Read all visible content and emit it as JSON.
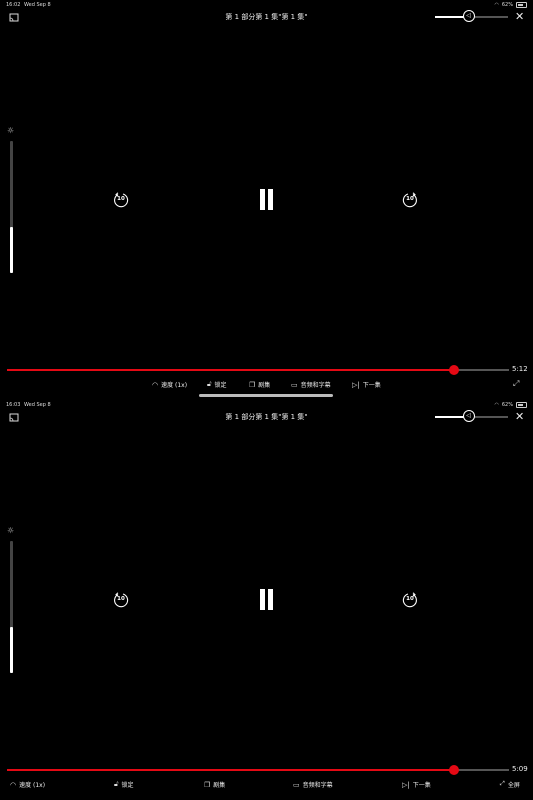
{
  "panels": [
    {
      "status": {
        "time": "16:02",
        "date": "Wed Sep 8",
        "battery": "62%"
      },
      "title": "第 1 部分第 1 集\"第 1 集\"",
      "volume_level": 0.46,
      "brightness_level": 0.35,
      "skip_back": "10",
      "skip_forward": "10",
      "progress": 0.89,
      "remaining": "5:12",
      "controls": {
        "speed": "速度 (1x)",
        "lock": "锁定",
        "episodes": "剧集",
        "audio_subtitles": "音频和字幕",
        "next": "下一集"
      }
    },
    {
      "status": {
        "time": "16:03",
        "date": "Wed Sep 8",
        "battery": "62%"
      },
      "title": "第 1 部分第 1 集\"第 1 集\"",
      "volume_level": 0.46,
      "brightness_level": 0.35,
      "skip_back": "10",
      "skip_forward": "10",
      "progress": 0.89,
      "remaining": "5:09",
      "controls": {
        "speed": "速度 (1x)",
        "lock": "锁定",
        "episodes": "剧集",
        "audio_subtitles": "音频和字幕",
        "next": "下一集",
        "fullscreen": "全屏"
      }
    }
  ],
  "colors": {
    "accent": "#e50914",
    "background": "#000000"
  },
  "icons": {
    "cast": "cast-icon",
    "volume": "volume-icon",
    "close": "close-icon",
    "brightness": "brightness-icon",
    "speed": "speedometer-icon",
    "lock": "lock-icon",
    "episodes": "episodes-icon",
    "subtitles": "subtitles-icon",
    "next": "next-episode-icon",
    "fullscreen": "fullscreen-icon"
  }
}
